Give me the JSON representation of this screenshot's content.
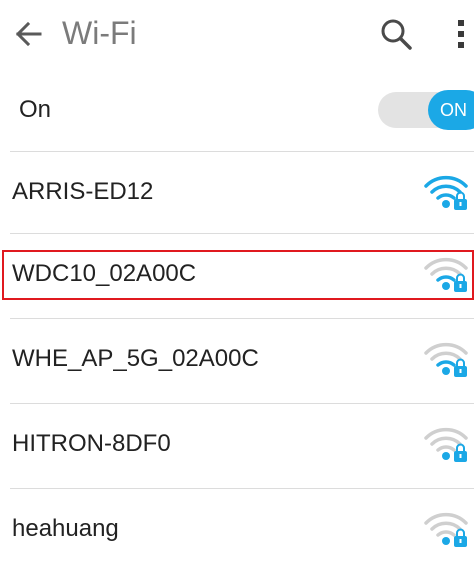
{
  "toolbar": {
    "title": "Wi-Fi",
    "back_icon": "arrow-back-icon",
    "search_icon": "search-icon",
    "more_icon": "more-vert-icon"
  },
  "wifi_toggle": {
    "label": "On",
    "state_text": "ON",
    "enabled": true
  },
  "networks": [
    {
      "name": "ARRIS-ED12",
      "signal_bars": 4,
      "secured": true
    },
    {
      "name": "WDC10_02A00C",
      "signal_bars": 2,
      "secured": true,
      "highlighted": true
    },
    {
      "name": "WHE_AP_5G_02A00C",
      "signal_bars": 2,
      "secured": true
    },
    {
      "name": "HITRON-8DF0",
      "signal_bars": 1,
      "secured": true
    },
    {
      "name": "heahuang",
      "signal_bars": 1,
      "secured": true
    }
  ],
  "colors": {
    "accent": "#1ba8e6",
    "signal_inactive": "#cfcfcf",
    "highlight_border": "#e0191f",
    "title_text": "#7b7b7b"
  }
}
